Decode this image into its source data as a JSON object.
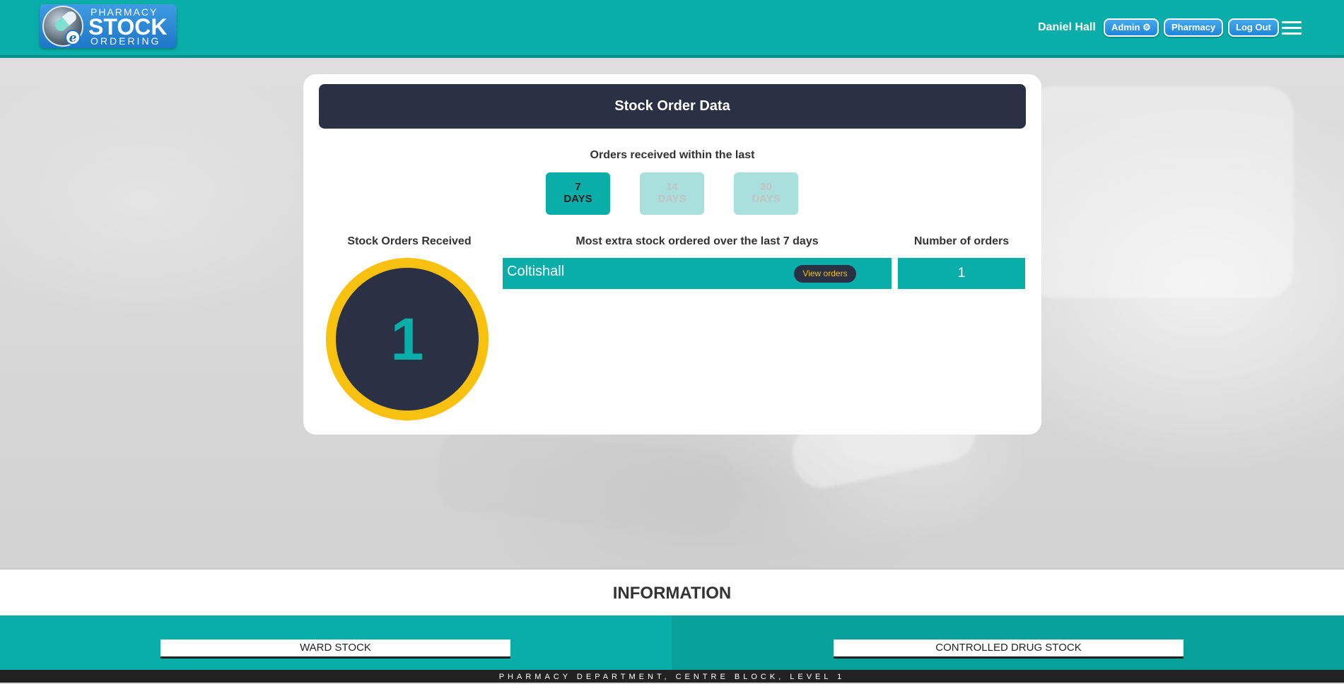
{
  "header": {
    "logo": {
      "line1": "PHARMACY",
      "line2": "STOCK",
      "line3": "ORDERING",
      "badge": "e"
    },
    "user_name": "Daniel Hall",
    "admin_label": "Admin",
    "admin_icon": "gear-icon",
    "pharmacy_label": "Pharmacy",
    "logout_label": "Log Out",
    "menu_icon": "hamburger-menu-icon"
  },
  "card": {
    "title": "Stock Order Data",
    "within_label": "Orders received within the last",
    "ranges": [
      {
        "num": "7",
        "unit": "DAYS",
        "active": true
      },
      {
        "num": "14",
        "unit": "DAYS",
        "active": false
      },
      {
        "num": "30",
        "unit": "DAYS",
        "active": false
      }
    ],
    "received_heading": "Stock Orders Received",
    "received_count": "1",
    "most_heading": "Most extra stock ordered over the last 7 days",
    "number_heading": "Number of orders",
    "rows": [
      {
        "ward": "Coltishall",
        "action": "View orders",
        "orders": "1"
      }
    ]
  },
  "info": {
    "title": "INFORMATION",
    "left_panel": "WARD STOCK",
    "right_panel": "CONTROLLED DRUG STOCK"
  },
  "footer": {
    "text": "PHARMACY DEPARTMENT, CENTRE BLOCK, LEVEL 1"
  },
  "colors": {
    "teal": "#0aaea8",
    "navy": "#2a3144",
    "gold": "#f8c10f",
    "button_blue": "#1f86d8"
  }
}
